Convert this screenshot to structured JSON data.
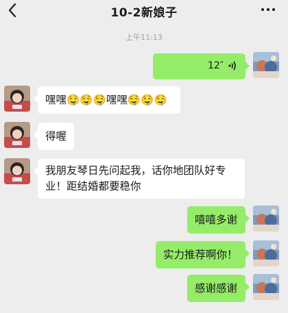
{
  "header": {
    "title": "10-2新娘子",
    "back_icon": "chevron-left-icon",
    "more_icon": "more-dots-icon"
  },
  "timestamp": "上午11:13",
  "colors": {
    "background": "#ededed",
    "incoming_bubble": "#ffffff",
    "outgoing_bubble": "#95ec69",
    "timestamp": "#a2a2a2"
  },
  "messages": [
    {
      "from": "self",
      "type": "voice",
      "duration": "12″",
      "icon": "voice-wave-icon"
    },
    {
      "from": "other",
      "type": "text",
      "text": "嘿嘿🤤🤤🤤嘿嘿🤤🤤🤤"
    },
    {
      "from": "other",
      "type": "text",
      "text": "得喔"
    },
    {
      "from": "other",
      "type": "text",
      "text": "我朋友琴日先问起我，话你地团队好专业！距结婚都要稳你"
    },
    {
      "from": "self",
      "type": "text",
      "text": "嘻嘻多谢"
    },
    {
      "from": "self",
      "type": "text",
      "text": "实力推荐啊你！"
    },
    {
      "from": "self",
      "type": "text",
      "text": "感谢感谢"
    }
  ]
}
